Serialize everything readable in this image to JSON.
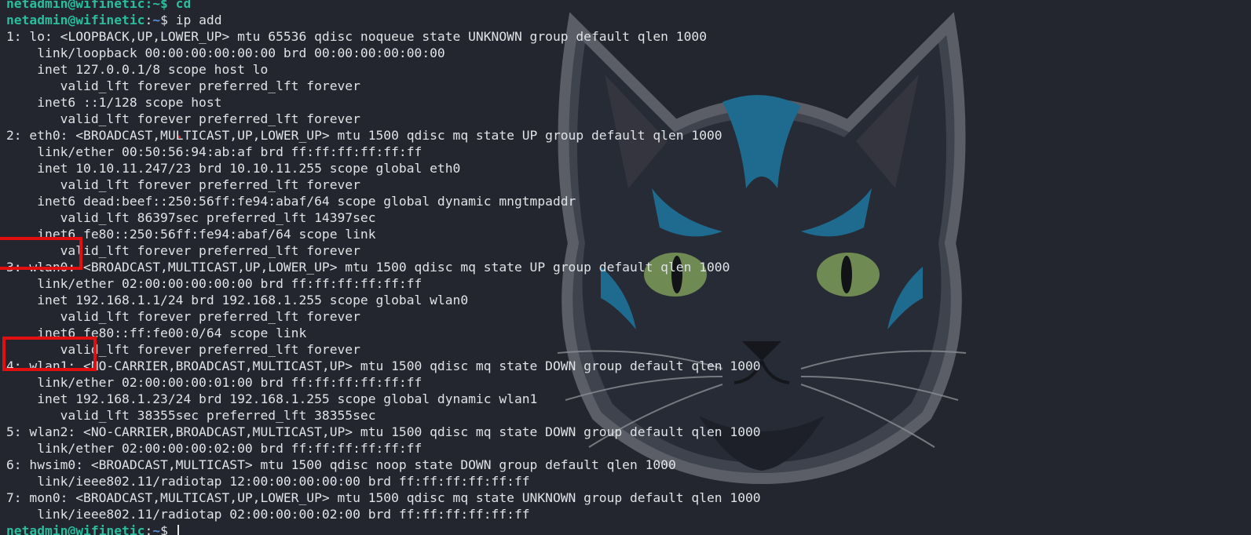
{
  "terminal": {
    "user_host": "netadmin@wifinetic",
    "colon": ":",
    "path": "~",
    "dollar": "$ ",
    "command": "ip add",
    "top_partial_line": "netadmin@wifinetic:~$ cd",
    "output": [
      "1: lo: <LOOPBACK,UP,LOWER_UP> mtu 65536 qdisc noqueue state UNKNOWN group default qlen 1000",
      "    link/loopback 00:00:00:00:00:00 brd 00:00:00:00:00:00",
      "    inet 127.0.0.1/8 scope host lo",
      "       valid_lft forever preferred_lft forever",
      "    inet6 ::1/128 scope host",
      "       valid_lft forever preferred_lft forever",
      "2: eth0: <BROADCAST,MULTICAST,UP,LOWER_UP> mtu 1500 qdisc mq state UP group default qlen 1000",
      "    link/ether 00:50:56:94:ab:af brd ff:ff:ff:ff:ff:ff",
      "    inet 10.10.11.247/23 brd 10.10.11.255 scope global eth0",
      "       valid_lft forever preferred_lft forever",
      "    inet6 dead:beef::250:56ff:fe94:abaf/64 scope global dynamic mngtmpaddr",
      "       valid_lft 86397sec preferred_lft 14397sec",
      "    inet6 fe80::250:56ff:fe94:abaf/64 scope link",
      "       valid_lft forever preferred_lft forever",
      "3: wlan0: <BROADCAST,MULTICAST,UP,LOWER_UP> mtu 1500 qdisc mq state UP group default qlen 1000",
      "    link/ether 02:00:00:00:00:00 brd ff:ff:ff:ff:ff:ff",
      "    inet 192.168.1.1/24 brd 192.168.1.255 scope global wlan0",
      "       valid_lft forever preferred_lft forever",
      "    inet6 fe80::ff:fe00:0/64 scope link",
      "       valid_lft forever preferred_lft forever",
      "4: wlan1: <NO-CARRIER,BROADCAST,MULTICAST,UP> mtu 1500 qdisc mq state DOWN group default qlen 1000",
      "    link/ether 02:00:00:00:01:00 brd ff:ff:ff:ff:ff:ff",
      "    inet 192.168.1.23/24 brd 192.168.1.255 scope global dynamic wlan1",
      "       valid_lft 38355sec preferred_lft 38355sec",
      "5: wlan2: <NO-CARRIER,BROADCAST,MULTICAST,UP> mtu 1500 qdisc mq state DOWN group default qlen 1000",
      "    link/ether 02:00:00:00:02:00 brd ff:ff:ff:ff:ff:ff",
      "6: hwsim0: <BROADCAST,MULTICAST> mtu 1500 qdisc noop state DOWN group default qlen 1000",
      "    link/ieee802.11/radiotap 12:00:00:00:00:00 brd ff:ff:ff:ff:ff:ff",
      "7: mon0: <BROADCAST,MULTICAST,UP,LOWER_UP> mtu 1500 qdisc mq state UNKNOWN group default qlen 1000",
      "    link/ieee802.11/radiotap 02:00:00:00:02:00 brd ff:ff:ff:ff:ff:ff"
    ]
  },
  "colors": {
    "background": "#23262e",
    "prompt_user": "#2bbd9e",
    "prompt_path": "#5a8fd8",
    "text": "#dfe2e6",
    "highlight": "#e10f0f"
  },
  "wallpaper": {
    "icon": "cat-head-icon"
  }
}
